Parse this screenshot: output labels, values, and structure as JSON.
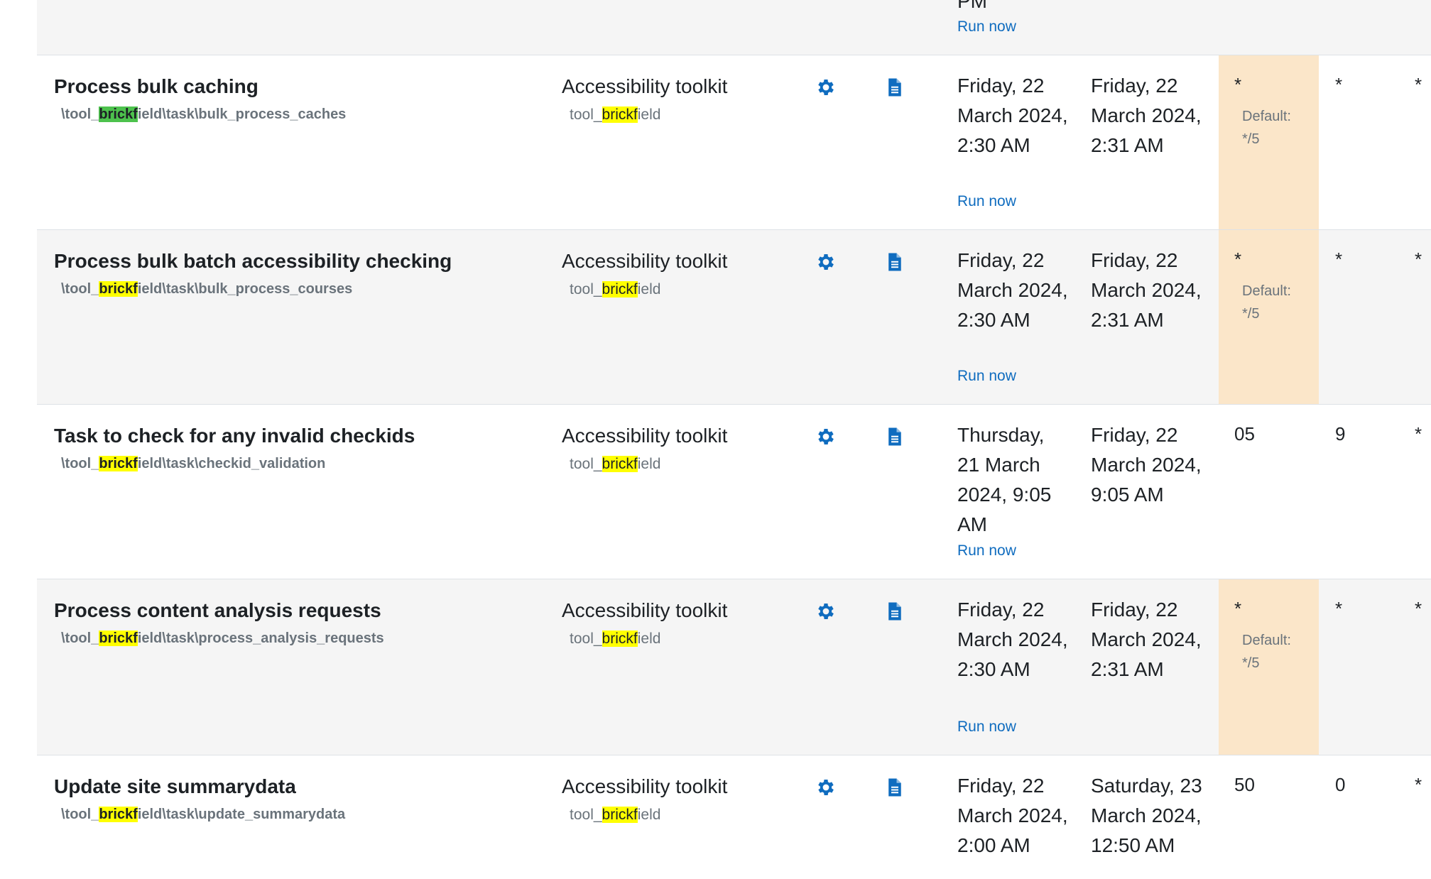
{
  "top_partial": {
    "last_run_tail": "PM",
    "run_now": "Run now"
  },
  "rows": [
    {
      "name": "Process bulk caching",
      "classname_pre": "\\tool_",
      "classname_hl": "brickf",
      "classname_post": "ield\\task\\bulk_process_caches",
      "highlight_color": "green",
      "component": "Accessibility toolkit",
      "component_pre": "tool_",
      "component_hl": "brickf",
      "component_post": "ield",
      "last_run": "Friday, 22 March 2024, 2:30 AM",
      "run_now": "Run now",
      "next_run": "Friday, 22 March 2024, 2:31 AM",
      "minute": "*",
      "minute_default": "Default: */5",
      "overridden": true,
      "hour": "*",
      "day": "*"
    },
    {
      "name": "Process bulk batch accessibility checking",
      "classname_pre": "\\tool_",
      "classname_hl": "brickf",
      "classname_post": "ield\\task\\bulk_process_courses",
      "highlight_color": "yellow",
      "component": "Accessibility toolkit",
      "component_pre": "tool_",
      "component_hl": "brickf",
      "component_post": "ield",
      "last_run": "Friday, 22 March 2024, 2:30 AM",
      "run_now": "Run now",
      "next_run": "Friday, 22 March 2024, 2:31 AM",
      "minute": "*",
      "minute_default": "Default: */5",
      "overridden": true,
      "hour": "*",
      "day": "*"
    },
    {
      "name": "Task to check for any invalid checkids",
      "classname_pre": "\\tool_",
      "classname_hl": "brickf",
      "classname_post": "ield\\task\\checkid_validation",
      "highlight_color": "yellow",
      "component": "Accessibility toolkit",
      "component_pre": "tool_",
      "component_hl": "brickf",
      "component_post": "ield",
      "last_run": "Thursday, 21 March 2024, 9:05 AM",
      "run_now": "Run now",
      "next_run": "Friday, 22 March 2024, 9:05 AM",
      "minute": "05",
      "minute_default": "",
      "overridden": false,
      "hour": "9",
      "day": "*"
    },
    {
      "name": "Process content analysis requests",
      "classname_pre": "\\tool_",
      "classname_hl": "brickf",
      "classname_post": "ield\\task\\process_analysis_requests",
      "highlight_color": "yellow",
      "component": "Accessibility toolkit",
      "component_pre": "tool_",
      "component_hl": "brickf",
      "component_post": "ield",
      "last_run": "Friday, 22 March 2024, 2:30 AM",
      "run_now": "Run now",
      "next_run": "Friday, 22 March 2024, 2:31 AM",
      "minute": "*",
      "minute_default": "Default: */5",
      "overridden": true,
      "hour": "*",
      "day": "*"
    },
    {
      "name": "Update site summarydata",
      "classname_pre": "\\tool_",
      "classname_hl": "brickf",
      "classname_post": "ield\\task\\update_summarydata",
      "highlight_color": "yellow",
      "component": "Accessibility toolkit",
      "component_pre": "tool_",
      "component_hl": "brickf",
      "component_post": "ield",
      "last_run": "Friday, 22 March 2024, 2:00 AM",
      "run_now": "Run now",
      "next_run": "Saturday, 23 March 2024, 12:50 AM",
      "minute": "50",
      "minute_default": "",
      "overridden": false,
      "hour": "0",
      "day": "*"
    }
  ],
  "icons": {
    "edit": "gear-icon",
    "log": "document-icon"
  },
  "colors": {
    "link": "#0f6cbf",
    "override_bg": "#fbe6c9",
    "highlight_yellow": "#ffff00",
    "highlight_green": "#4dc24d"
  }
}
